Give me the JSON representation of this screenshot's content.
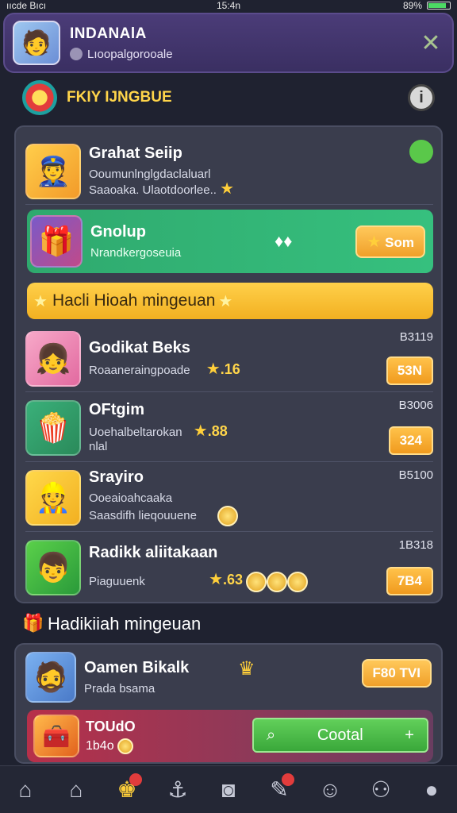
{
  "status_bar": {
    "left": "ııcde Bıcı",
    "time": "15:4n",
    "battery": "89%"
  },
  "profile": {
    "name": "INDANAlA",
    "subtitle": "Lıoopalgorooale"
  },
  "section": {
    "title": "FKIY IJNGBUE"
  },
  "rows": [
    {
      "title": "Grahat Seiip",
      "sub1": "Ooumunlnglgdaclaluarl",
      "sub2": "Saaoaka. Ulaotdoorlee.."
    },
    {
      "title": "Gnolup",
      "sub1": "Nrandkergoseuia",
      "chip": "Som"
    },
    {
      "strip": "Hacli Hioah mingeuan"
    },
    {
      "title": "Godikat Beks",
      "sub1": "Roaaneraingpoade",
      "points": ".16",
      "price": "B3119",
      "btn": "53N"
    },
    {
      "title": "OFtgim",
      "sub1": "Uoehalbeltarokan",
      "sub2": "nlal",
      "points": ".88",
      "price": "B3006",
      "btn": "324"
    },
    {
      "title": "Srayiro",
      "sub1": "Ooeaioahcaaka",
      "sub2": "Saasdifh lieqouuene",
      "price": "B5100"
    },
    {
      "title": "Radikk aliitakaan",
      "sub1": "Piaguuenk",
      "points": ".63",
      "price": "1B318",
      "btn": "7B4"
    }
  ],
  "week": {
    "title": "Hadikiiah mingeuan"
  },
  "bottom": {
    "title": "Oamen Bikalk",
    "sub": "Prada bsama",
    "chip": "F80 TVI",
    "red_title": "TOUdO",
    "red_nums": "1b4o",
    "collect": "Cootal"
  },
  "icons": {
    "close": "close-icon",
    "info": "info-icon",
    "nav": [
      "home-icon",
      "home-icon",
      "trophy-icon",
      "anchor-icon",
      "gamepad-icon",
      "chat-icon",
      "smile-icon",
      "users-icon",
      "profile-icon"
    ]
  }
}
